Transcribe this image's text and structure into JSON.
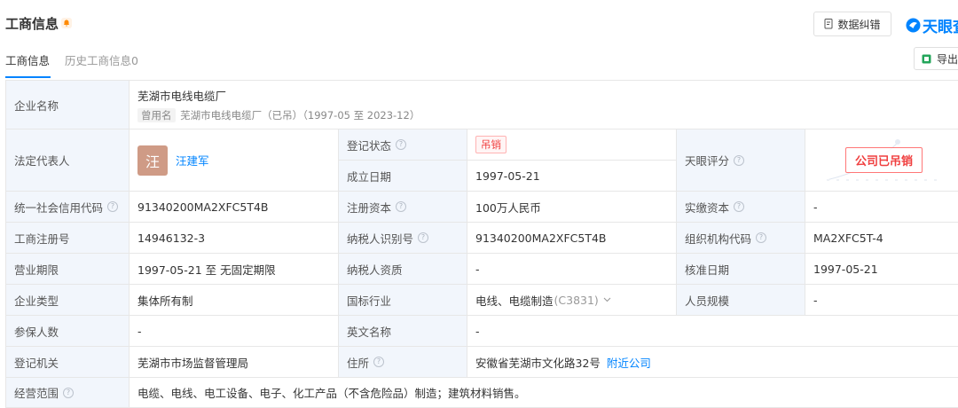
{
  "header": {
    "title": "工商信息",
    "correct_button": "数据纠错",
    "brand": "天眼查"
  },
  "tabs": [
    {
      "label": "工商信息"
    },
    {
      "label": "历史工商信息0"
    }
  ],
  "export_button": "导出",
  "company": {
    "name_label": "企业名称",
    "name": "芜湖市电线电缆厂",
    "former_tag": "曾用名",
    "former_name": "芜湖市电线电缆厂（已吊）（1997-05 至 2023-12）",
    "rep_label": "法定代表人",
    "rep_avatar": "汪",
    "rep_name": "汪建军",
    "status_label": "登记状态",
    "status": "吊销",
    "found_label": "成立日期",
    "found_date": "1997-05-21",
    "score_label": "天眼评分",
    "score_stamp": "公司已吊销",
    "credit_code_label": "统一社会信用代码",
    "credit_code": "91340200MA2XFC5T4B",
    "reg_capital_label": "注册资本",
    "reg_capital": "100万人民币",
    "paid_capital_label": "实缴资本",
    "paid_capital": "-",
    "reg_no_label": "工商注册号",
    "reg_no": "14946132-3",
    "taxpayer_id_label": "纳税人识别号",
    "taxpayer_id": "91340200MA2XFC5T4B",
    "org_code_label": "组织机构代码",
    "org_code": "MA2XFC5T-4",
    "term_label": "营业期限",
    "term": "1997-05-21 至 无固定期限",
    "taxpayer_qual_label": "纳税人资质",
    "taxpayer_qual": "-",
    "approve_label": "核准日期",
    "approve_date": "1997-05-21",
    "type_label": "企业类型",
    "type": "集体所有制",
    "industry_label": "国标行业",
    "industry": "电线、电缆制造",
    "industry_code": "(C3831)",
    "staff_label": "人员规模",
    "staff": "-",
    "insured_label": "参保人数",
    "insured": "-",
    "en_name_label": "英文名称",
    "en_name": "-",
    "authority_label": "登记机关",
    "authority": "芜湖市市场监督管理局",
    "address_label": "住所",
    "address": "安徽省芜湖市文化路32号",
    "nearby_link": "附近公司",
    "scope_label": "经营范围",
    "scope": "电缆、电线、电工设备、电子、化工产品（不含危险品）制造；建筑材料销售。"
  }
}
